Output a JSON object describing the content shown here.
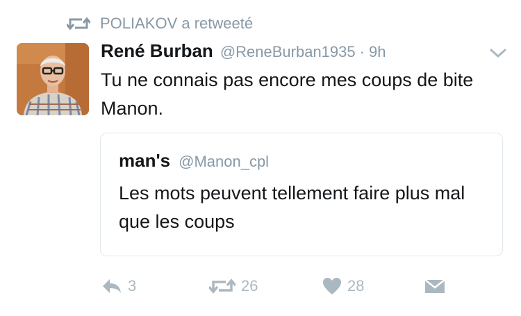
{
  "retweet_header": {
    "text": "POLIAKOV a retweeté",
    "icon": "retweet-icon"
  },
  "tweet": {
    "author_name": "René Burban",
    "author_handle": "@ReneBurban1935",
    "separator": "·",
    "timestamp": "9h",
    "text": "Tu ne connais pas encore mes coups de bite Manon.",
    "menu_icon": "chevron-down-icon"
  },
  "quoted_tweet": {
    "author_name": "man's",
    "author_handle": "@Manon_cpl",
    "text": "Les mots peuvent tellement faire plus mal que les coups"
  },
  "actions": {
    "reply": {
      "icon": "reply-icon",
      "count": "3"
    },
    "retweet": {
      "icon": "retweet-icon",
      "count": "26"
    },
    "like": {
      "icon": "heart-icon",
      "count": "28"
    },
    "message": {
      "icon": "envelope-icon"
    }
  },
  "colors": {
    "muted": "#8899a6",
    "action": "#aab8c2",
    "text": "#14171a",
    "border": "#e1e8ed"
  }
}
